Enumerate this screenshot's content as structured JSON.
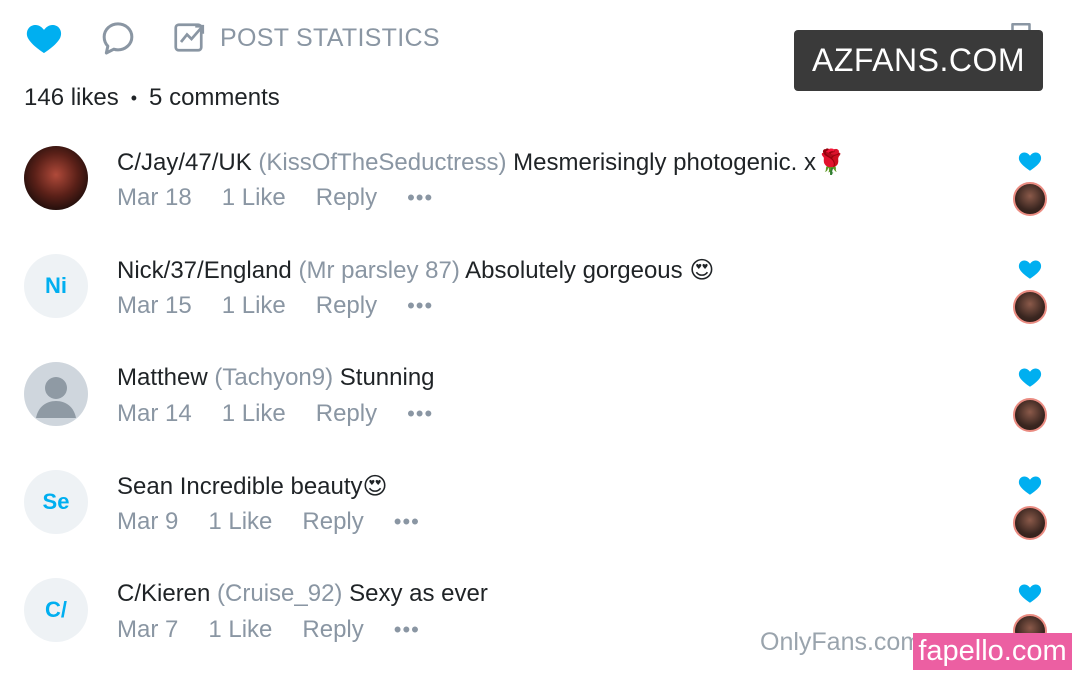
{
  "toolbar": {
    "stats_label": "POST STATISTICS",
    "icons": [
      "heart-icon",
      "comment-icon",
      "chart-icon",
      "bookmark-icon"
    ]
  },
  "summary": {
    "likes": "146 likes",
    "separator": "•",
    "comments": "5 comments"
  },
  "watermarks": {
    "azfans": "AZFANS.COM",
    "onlyfans": "OnlyFans.com",
    "fapello": "fapello.com"
  },
  "comments": [
    {
      "avatar_text": "",
      "author": "C/Jay/47/UK",
      "handle": "(KissOfTheSeductress)",
      "text": "Mesmerisingly photogenic. x🌹",
      "date": "Mar 18",
      "likes": "1 Like",
      "reply": "Reply",
      "more": "•••"
    },
    {
      "avatar_text": "Ni",
      "author": "Nick/37/England",
      "handle": "(Mr parsley 87)",
      "text": "Absolutely gorgeous 😍",
      "date": "Mar 15",
      "likes": "1 Like",
      "reply": "Reply",
      "more": "•••"
    },
    {
      "avatar_text": "",
      "author": "Matthew",
      "handle": "(Tachyon9)",
      "text": "Stunning",
      "date": "Mar 14",
      "likes": "1 Like",
      "reply": "Reply",
      "more": "•••"
    },
    {
      "avatar_text": "Se",
      "author": "Sean",
      "handle": "",
      "text": "Incredible beauty😍",
      "date": "Mar 9",
      "likes": "1 Like",
      "reply": "Reply",
      "more": "•••"
    },
    {
      "avatar_text": "C/",
      "author": "C/Kieren",
      "handle": "(Cruise_92)",
      "text": "Sexy as ever",
      "date": "Mar 7",
      "likes": "1 Like",
      "reply": "Reply",
      "more": "•••"
    }
  ],
  "colors": {
    "accent": "#00aff0",
    "muted": "#8a96a3",
    "text": "#1f2326"
  }
}
